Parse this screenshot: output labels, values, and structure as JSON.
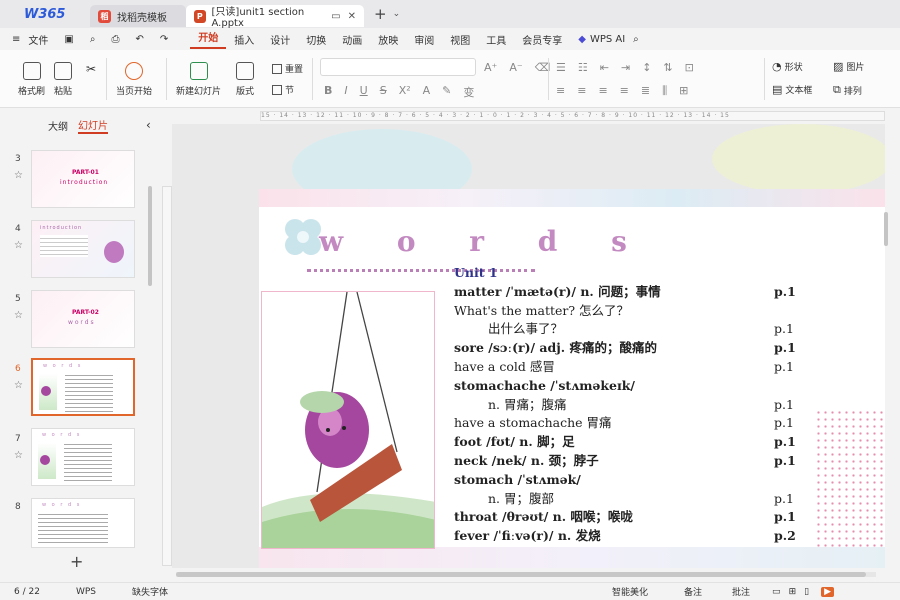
{
  "tabs": {
    "logo": "W365",
    "template_tab": "找稻壳模板",
    "file_tab": "[只读]unit1 section A.pptx"
  },
  "menu": {
    "file": "文件",
    "items": [
      "开始",
      "插入",
      "设计",
      "切换",
      "动画",
      "放映",
      "审阅",
      "视图",
      "工具",
      "会员专享"
    ],
    "active": "开始",
    "wps_ai": "WPS AI"
  },
  "ribbon": {
    "format_painter": "格式刷",
    "paste": "粘贴",
    "from_start": "当页开始",
    "new_slide": "新建幻灯片",
    "layout": "版式",
    "reset": "重置",
    "section": "节",
    "shape": "形状",
    "picture": "图片",
    "textbox": "文本框",
    "arrange": "排列"
  },
  "panel": {
    "outline_tab": "大纲",
    "slides_tab": "幻灯片"
  },
  "thumbs": [
    {
      "num": "3",
      "label": "PART-01",
      "sub": "introduction"
    },
    {
      "num": "4",
      "label": "introduction"
    },
    {
      "num": "5",
      "label": "PART-02",
      "sub": "w o r d s"
    },
    {
      "num": "6",
      "label": "w o r d s"
    },
    {
      "num": "7",
      "label": "w o r d s"
    },
    {
      "num": "8",
      "label": "w o r d s"
    }
  ],
  "slide": {
    "title": "w o r d s",
    "rows": [
      {
        "text": "Unit 1",
        "page": "",
        "cls": "b"
      },
      {
        "text": "matter /ˈmætə(r)/ n. 问题；事情",
        "page": "p.1",
        "cls": "b"
      },
      {
        "text": "What's the matter? 怎么了？",
        "page": "",
        "cls": ""
      },
      {
        "text": "出什么事了？",
        "page": "p.1",
        "cls": "indent"
      },
      {
        "text": "sore /sɔː(r)/ adj. 疼痛的；酸痛的",
        "page": "p.1",
        "cls": "b"
      },
      {
        "text": "have a cold 感冒",
        "page": "p.1",
        "cls": ""
      },
      {
        "text": "stomachache /ˈstʌməkeɪk/",
        "page": "",
        "cls": "b"
      },
      {
        "text": "n. 胃痛；腹痛",
        "page": "p.1",
        "cls": "indent"
      },
      {
        "text": "have a stomachache 胃痛",
        "page": "p.1",
        "cls": ""
      },
      {
        "text": "foot /fʊt/ n. 脚；足",
        "page": "p.1",
        "cls": "b"
      },
      {
        "text": "neck /nek/ n. 颈；脖子",
        "page": "p.1",
        "cls": "b"
      },
      {
        "text": "stomach /ˈstʌmək/",
        "page": "",
        "cls": "b"
      },
      {
        "text": "n. 胃；腹部",
        "page": "p.1",
        "cls": "indent"
      },
      {
        "text": "throat /θrəʊt/ n. 咽喉；喉咙",
        "page": "p.1",
        "cls": "b"
      },
      {
        "text": "fever /ˈfiːvə(r)/ n. 发烧",
        "page": "p.2",
        "cls": "b"
      }
    ]
  },
  "ruler": "15 · 14 · 13 · 12 · 11 · 10 · 9 · 8 · 7 · 6 · 5 · 4 · 3 · 2 · 1 · 0 · 1 · 2 · 3 · 4 · 5 · 6 · 7 · 8 · 9 · 10 · 11 · 12 · 13 · 14 · 15",
  "status": {
    "page": "6 / 22",
    "wps": "WPS",
    "missing_font": "缺失字体",
    "beautify": "智能美化",
    "notes": "备注",
    "comments": "批注"
  },
  "colors": {
    "accent": "#d03c22",
    "title": "#c38ac1",
    "thumb_selected": "#e0662b"
  }
}
